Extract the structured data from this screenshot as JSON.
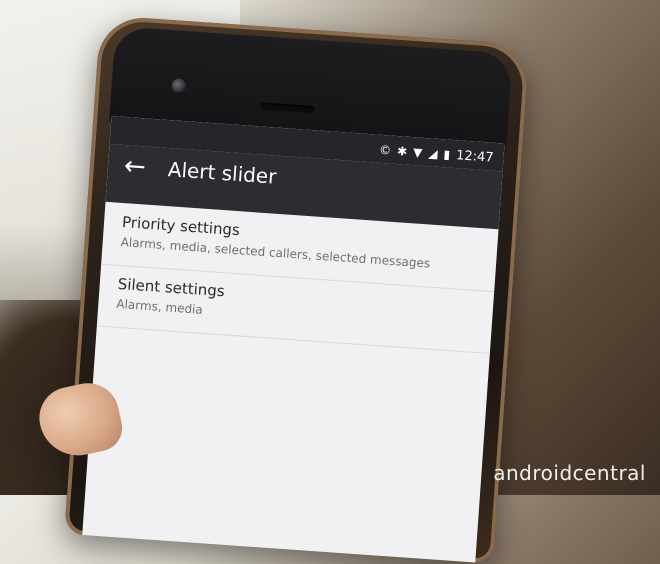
{
  "toolbar": {
    "title": "Alert slider",
    "back_icon": "arrow-back-icon"
  },
  "status_bar": {
    "time": "12:47",
    "icons": [
      "copyright-icon",
      "bluetooth-icon",
      "wifi-icon",
      "signal-icon",
      "battery-icon"
    ]
  },
  "settings": {
    "items": [
      {
        "title": "Priority settings",
        "subtitle": "Alarms, media, selected callers, selected messages"
      },
      {
        "title": "Silent settings",
        "subtitle": "Alarms, media"
      }
    ]
  },
  "watermark": "androidcentral"
}
